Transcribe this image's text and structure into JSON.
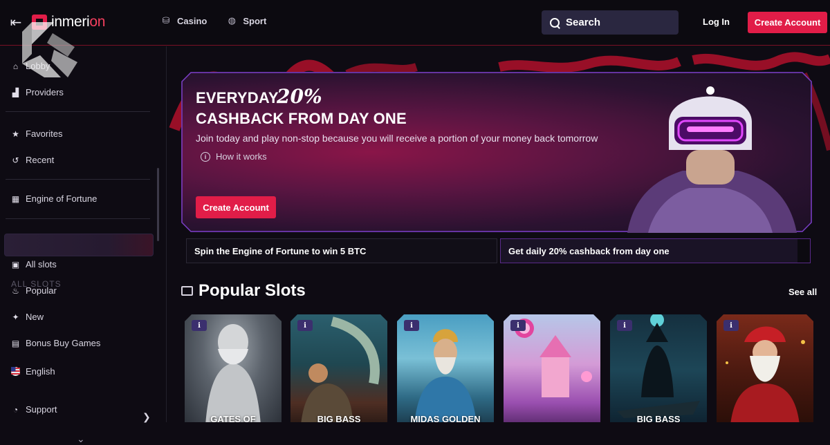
{
  "header": {
    "logo_prefix": "inmeri",
    "logo_suffix": "on",
    "nav": [
      {
        "label": "Casino",
        "icon": "casino-chips-icon"
      },
      {
        "label": "Sport",
        "icon": "volleyball-icon"
      }
    ],
    "search_label": "Search",
    "login_label": "Log In",
    "create_account_label": "Create Account"
  },
  "sidebar": {
    "items_top": [
      {
        "label": "Lobby",
        "icon": "home-icon"
      },
      {
        "label": "Providers",
        "icon": "factory-icon"
      }
    ],
    "items_personal": [
      {
        "label": "Favorites",
        "icon": "star-icon"
      },
      {
        "label": "Recent",
        "icon": "history-icon"
      }
    ],
    "active_item": {
      "label": "Engine of Fortune",
      "icon": "grid-icon"
    },
    "slots_heading": "ALL SLOTS",
    "items_slots": [
      {
        "label": "All slots",
        "icon": "slot-machine-icon"
      },
      {
        "label": "Popular",
        "icon": "flame-icon"
      },
      {
        "label": "New",
        "icon": "sparkle-icon"
      },
      {
        "label": "Bonus Buy Games",
        "icon": "gift-box-icon"
      }
    ],
    "language": {
      "label": "English",
      "icon": "us-flag-icon"
    },
    "support_label": "Support"
  },
  "banner": {
    "title_line1": "EVERYDAY",
    "title_percent": "20%",
    "title_line2": "CASHBACK FROM DAY ONE",
    "subtitle": "Join today and play non-stop because you will receive a portion of your money back tomorrow",
    "how_it_works": "How it works",
    "cta_label": "Create Account"
  },
  "promos": [
    "Spin the Engine of Fortune to win 5 BTC",
    "Get daily 20% cashback from day one"
  ],
  "popular": {
    "title": "Popular Slots",
    "see_all": "See all",
    "games": [
      {
        "name": "GATES OF",
        "info": "i"
      },
      {
        "name": "BIG BASS",
        "info": "i"
      },
      {
        "name": "MIDAS GOLDEN",
        "info": "i"
      },
      {
        "name": "",
        "info": "i"
      },
      {
        "name": "BIG BASS",
        "info": "i"
      },
      {
        "name": "",
        "info": "i"
      }
    ]
  },
  "colors": {
    "accent": "#e11d48",
    "background": "#0e0b13",
    "search_bg": "#2a2740",
    "banner_border": "#7b3fc8"
  }
}
